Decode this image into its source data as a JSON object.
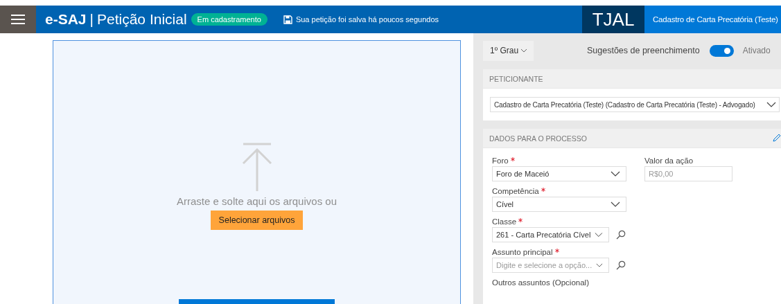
{
  "header": {
    "app_name": "e-SAJ",
    "separator": "|",
    "page_title": "Petição Inicial",
    "status_badge": "Em cadastramento",
    "save_status": "Sua petição foi salva há poucos segundos",
    "court": "TJAL",
    "user": "Cadastro de Carta Precatória (Teste)"
  },
  "upload": {
    "hint": "Arraste e solte aqui os arquivos ou",
    "select_button": "Selecionar arquivos"
  },
  "options": {
    "instance": "1º Grau",
    "suggestions_label": "Sugestões de preenchimento",
    "suggestions_on": true,
    "suggestions_state": "Ativado"
  },
  "peticionante": {
    "title": "PETICIONANTE",
    "value": "Cadastro de Carta Precatória (Teste) (Cadastro de Carta Precatória (Teste) - Advogado)"
  },
  "process": {
    "title": "DADOS PARA O PROCESSO",
    "fields": [
      {
        "label": "Foro",
        "required": true,
        "kind": "select",
        "value": "Foro de Maceió"
      },
      {
        "label": "Valor da ação",
        "required": false,
        "kind": "text",
        "placeholder": "R$0,00"
      },
      {
        "label": "Competência",
        "required": true,
        "kind": "select",
        "value": "Cível"
      },
      {
        "label": "Classe",
        "required": true,
        "kind": "search",
        "value": "261 - Carta Precatória Cível"
      },
      {
        "label": "Assunto principal",
        "required": true,
        "kind": "search",
        "placeholder": "Digite e selecione a opção..."
      }
    ],
    "more_label": "Outros assuntos (Opcional)"
  }
}
